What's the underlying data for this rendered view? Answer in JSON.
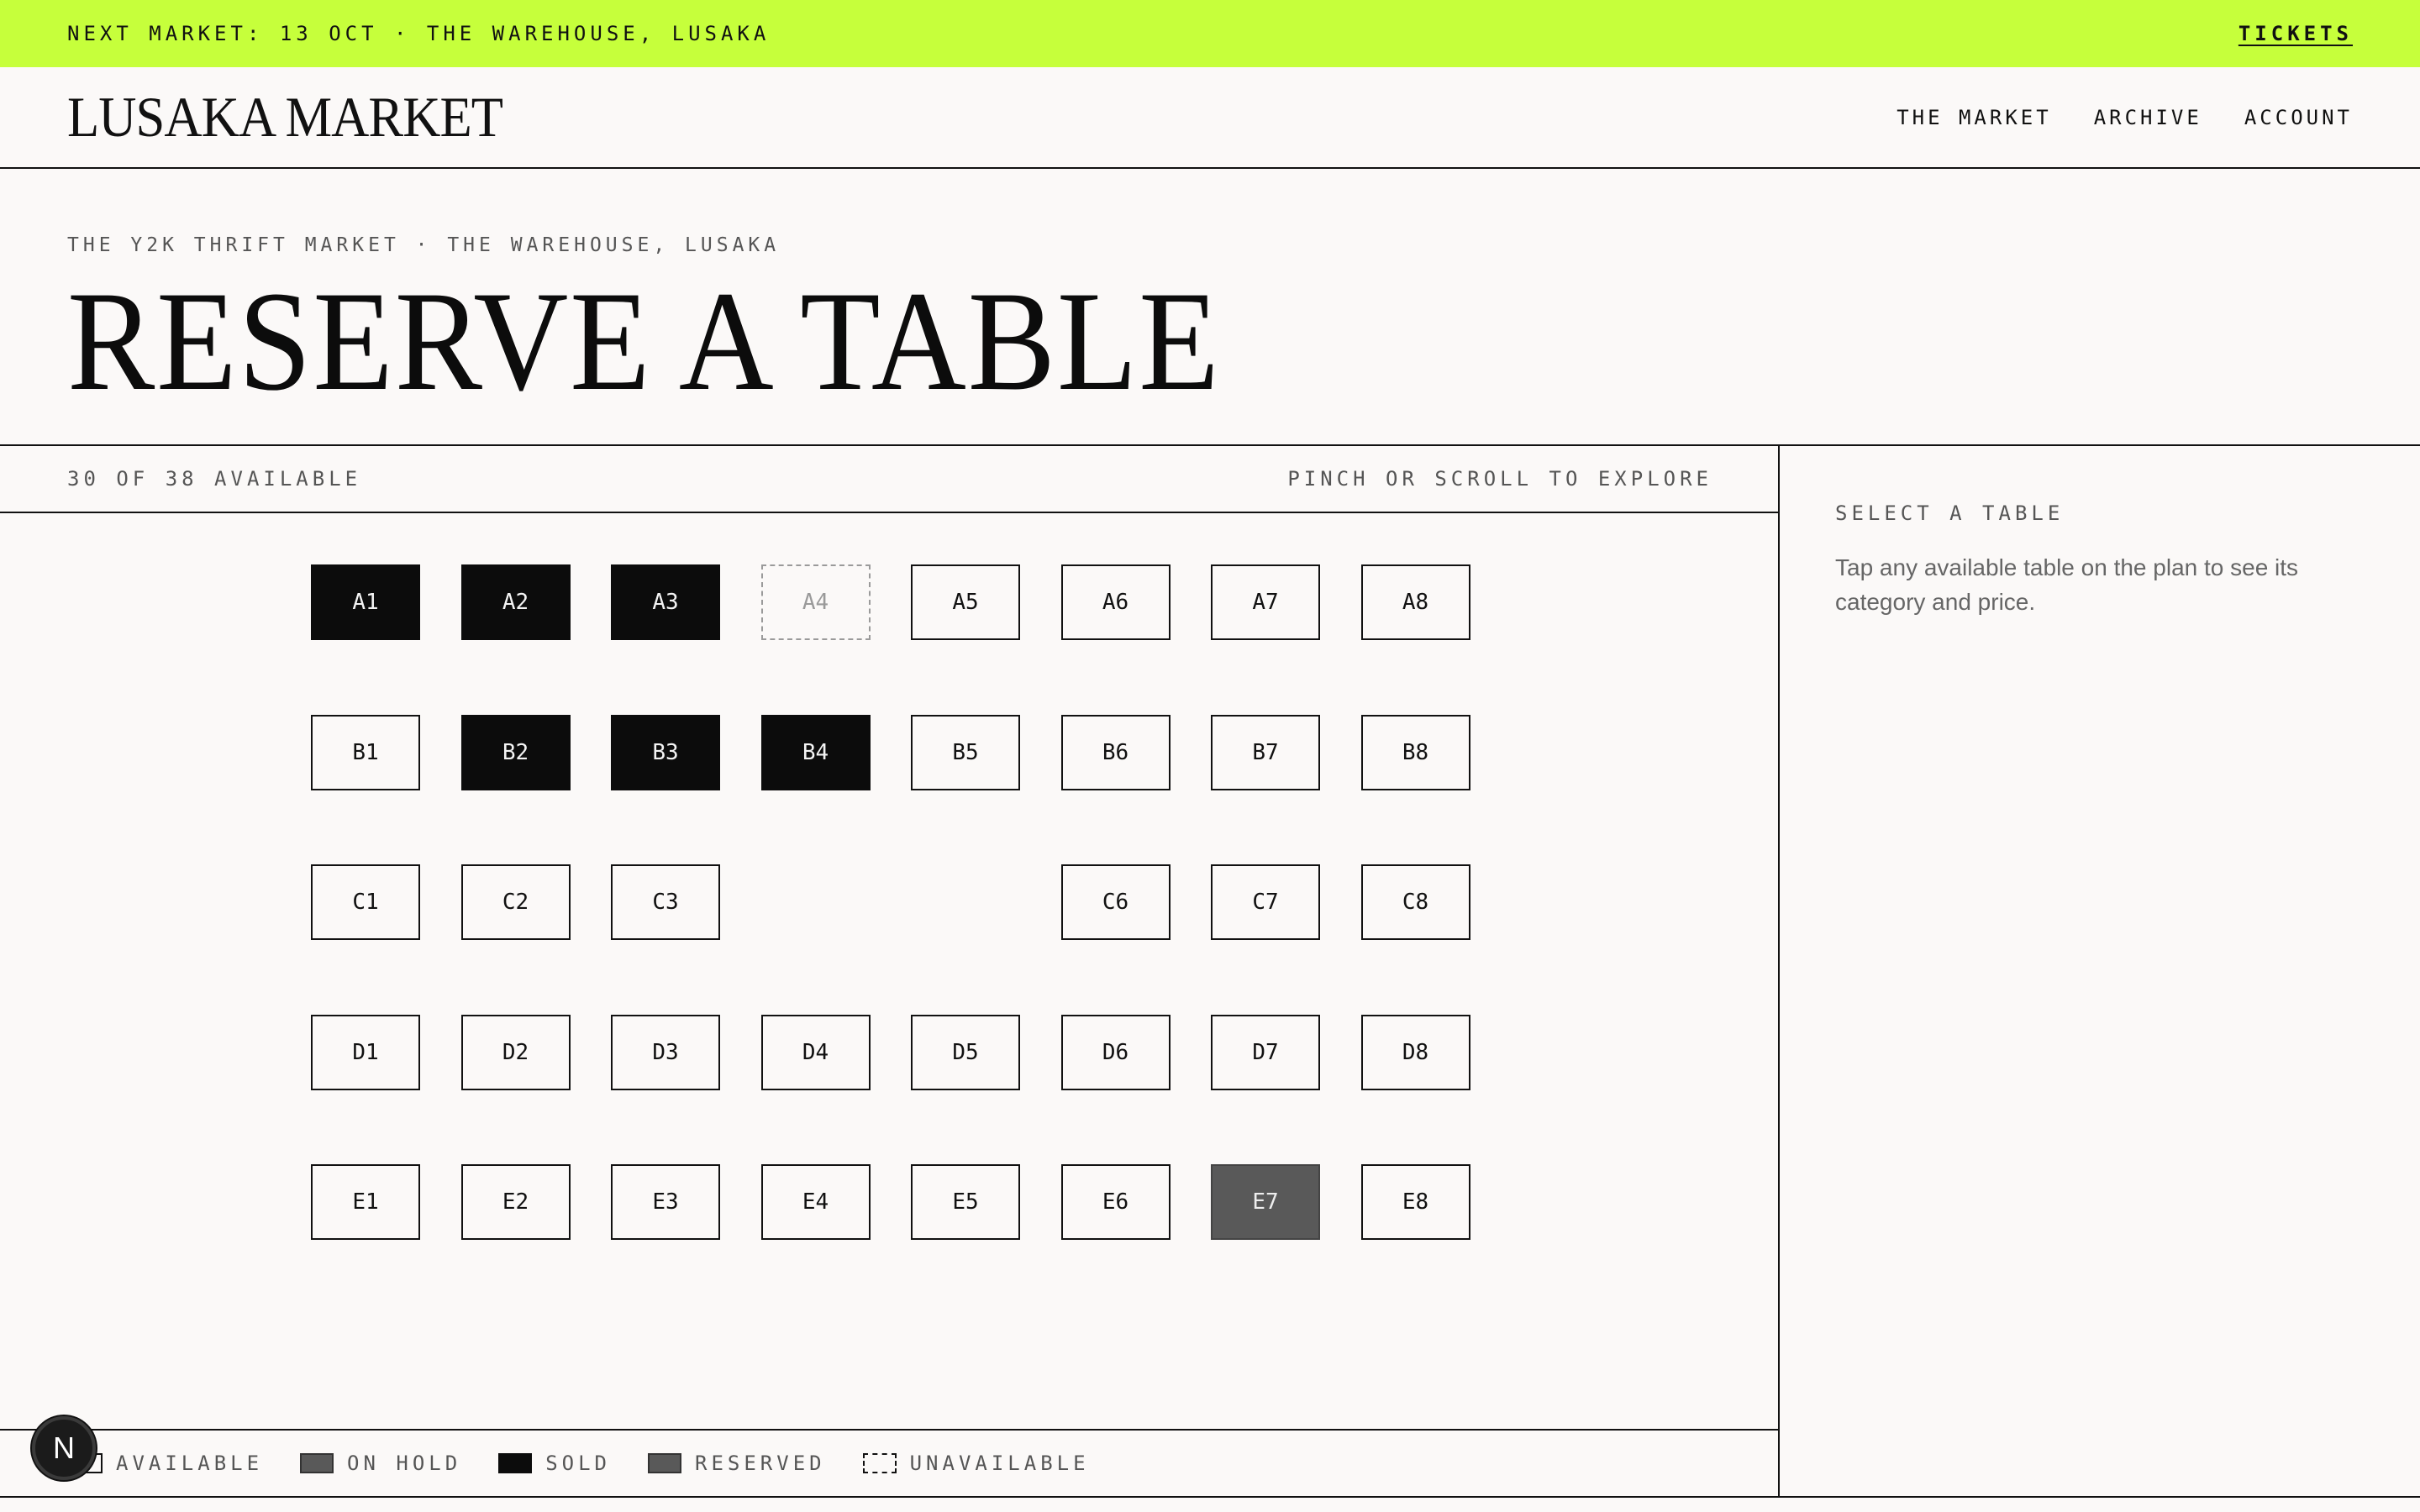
{
  "banner": {
    "text": "NEXT MARKET: 13 OCT · THE WAREHOUSE, LUSAKA",
    "tickets_label": "TICKETS",
    "background": "#c6ff3b"
  },
  "header": {
    "logo": "LUSAKA MARKET",
    "nav": [
      "THE MARKET",
      "ARCHIVE",
      "ACCOUNT"
    ]
  },
  "hero": {
    "eyebrow": "THE Y2K THRIFT MARKET · THE WAREHOUSE, LUSAKA",
    "title": "RESERVE A TABLE"
  },
  "plan": {
    "availability": "30 OF 38 AVAILABLE",
    "hint": "PINCH OR SCROLL TO EXPLORE",
    "tables": [
      {
        "label": "A1",
        "status": "sold"
      },
      {
        "label": "A2",
        "status": "sold"
      },
      {
        "label": "A3",
        "status": "sold"
      },
      {
        "label": "A4",
        "status": "unavailable"
      },
      {
        "label": "A5",
        "status": "available"
      },
      {
        "label": "A6",
        "status": "available"
      },
      {
        "label": "A7",
        "status": "available"
      },
      {
        "label": "A8",
        "status": "available"
      },
      {
        "label": "B1",
        "status": "available"
      },
      {
        "label": "B2",
        "status": "sold"
      },
      {
        "label": "B3",
        "status": "sold"
      },
      {
        "label": "B4",
        "status": "sold"
      },
      {
        "label": "B5",
        "status": "available"
      },
      {
        "label": "B6",
        "status": "available"
      },
      {
        "label": "B7",
        "status": "available"
      },
      {
        "label": "B8",
        "status": "available"
      },
      {
        "label": "C1",
        "status": "available"
      },
      {
        "label": "C2",
        "status": "available"
      },
      {
        "label": "C3",
        "status": "available"
      },
      {
        "label": "C6",
        "status": "available"
      },
      {
        "label": "C7",
        "status": "available"
      },
      {
        "label": "C8",
        "status": "available"
      },
      {
        "label": "D1",
        "status": "available"
      },
      {
        "label": "D2",
        "status": "available"
      },
      {
        "label": "D3",
        "status": "available"
      },
      {
        "label": "D4",
        "status": "available"
      },
      {
        "label": "D5",
        "status": "available"
      },
      {
        "label": "D6",
        "status": "available"
      },
      {
        "label": "D7",
        "status": "available"
      },
      {
        "label": "D8",
        "status": "available"
      },
      {
        "label": "E1",
        "status": "available"
      },
      {
        "label": "E2",
        "status": "available"
      },
      {
        "label": "E3",
        "status": "available"
      },
      {
        "label": "E4",
        "status": "available"
      },
      {
        "label": "E5",
        "status": "available"
      },
      {
        "label": "E6",
        "status": "available"
      },
      {
        "label": "E7",
        "status": "hold"
      },
      {
        "label": "E8",
        "status": "available"
      }
    ],
    "legend": [
      {
        "key": "available",
        "label": "AVAILABLE"
      },
      {
        "key": "hold",
        "label": "ON HOLD"
      },
      {
        "key": "sold",
        "label": "SOLD"
      },
      {
        "key": "reserved",
        "label": "RESERVED"
      },
      {
        "key": "unavailable",
        "label": "UNAVAILABLE"
      }
    ]
  },
  "side": {
    "label": "SELECT A TABLE",
    "help": "Tap any available table on the plan to see its category and price."
  },
  "badge": {
    "letter": "N"
  }
}
